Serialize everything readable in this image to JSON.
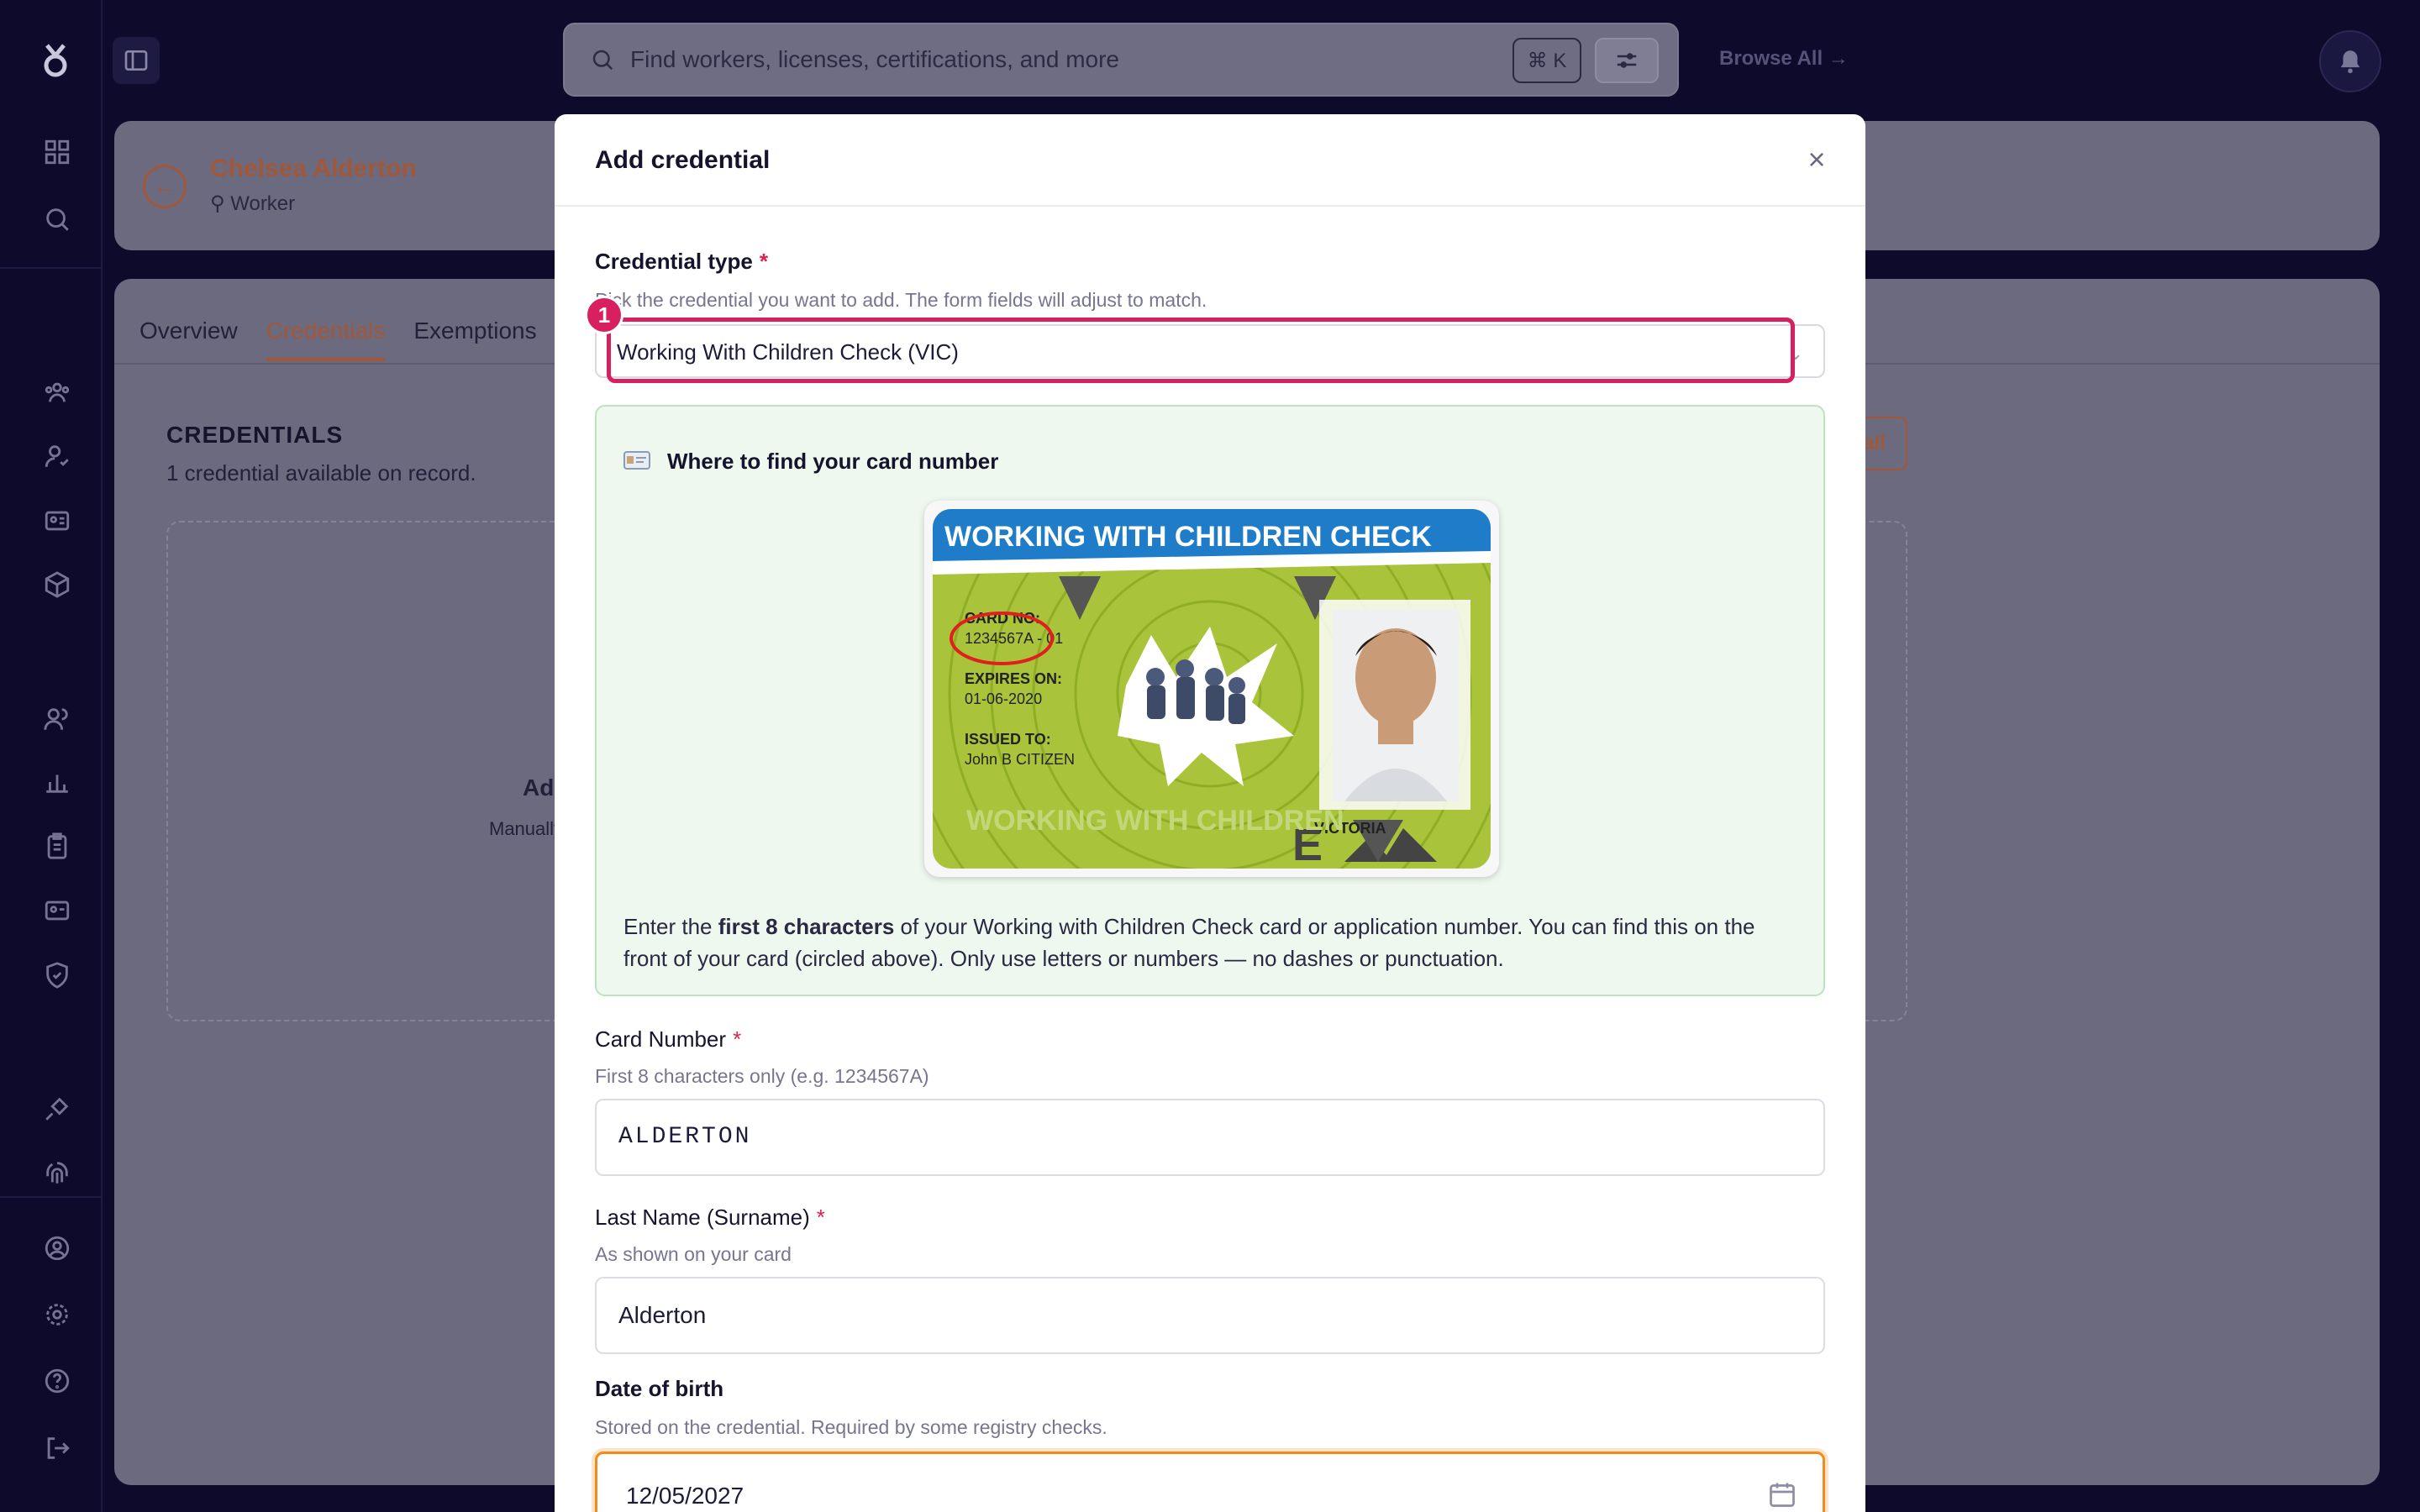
{
  "topbar": {
    "search_placeholder": "Find workers, licenses, certifications, and more",
    "shortcut": "⌘ K",
    "browse_all": "Browse All →"
  },
  "worker": {
    "name": "Chelsea Alderton",
    "role": "Worker"
  },
  "tabs": [
    "Overview",
    "Credentials",
    "Exemptions"
  ],
  "credentials_panel": {
    "title": "CREDENTIALS",
    "subtitle": "1 credential available on record.",
    "ghost_add": "Add",
    "ghost_manual": "Manually",
    "ghost_button": "all"
  },
  "modal": {
    "title": "Add credential",
    "close": "×",
    "credential_type": {
      "label": "Credential type",
      "required": "*",
      "help": "Pick the credential you want to add. The form fields will adjust to match.",
      "value": "Working With Children Check (VIC)"
    },
    "annotation_badge": "1",
    "info": {
      "title": "Where to find your card number",
      "text_before": "Enter the ",
      "text_bold": "first 8 characters",
      "text_after": " of your Working with Children Check card or application number. You can find this on the front of your card (circled above). Only use letters or numbers — no dashes or punctuation."
    },
    "sample_card": {
      "heading": "WORKING WITH CHILDREN CHECK",
      "card_no_label": "CARD NO:",
      "card_no": "1234567A - 01",
      "expires_label": "EXPIRES ON:",
      "expires": "01-06-2020",
      "issued_label": "ISSUED TO:",
      "issued": "John B CITIZEN",
      "watermark": "WORKING WITH CHILDREN",
      "state": "VICTORIA",
      "letter": "E"
    },
    "card_number": {
      "label": "Card Number",
      "required": "*",
      "help": "First 8 characters only (e.g. 1234567A)",
      "value": "ALDERTON"
    },
    "last_name": {
      "label": "Last Name (Surname)",
      "required": "*",
      "help": "As shown on your card",
      "value": "Alderton"
    },
    "dob": {
      "label": "Date of birth",
      "help": "Stored on the credential. Required by some registry checks.",
      "value": "12/05/2027"
    }
  },
  "colors": {
    "background": "#0d0a2b",
    "accent": "#f28a1e",
    "highlight": "#d81f5f",
    "info_bg": "#eef8ee"
  }
}
